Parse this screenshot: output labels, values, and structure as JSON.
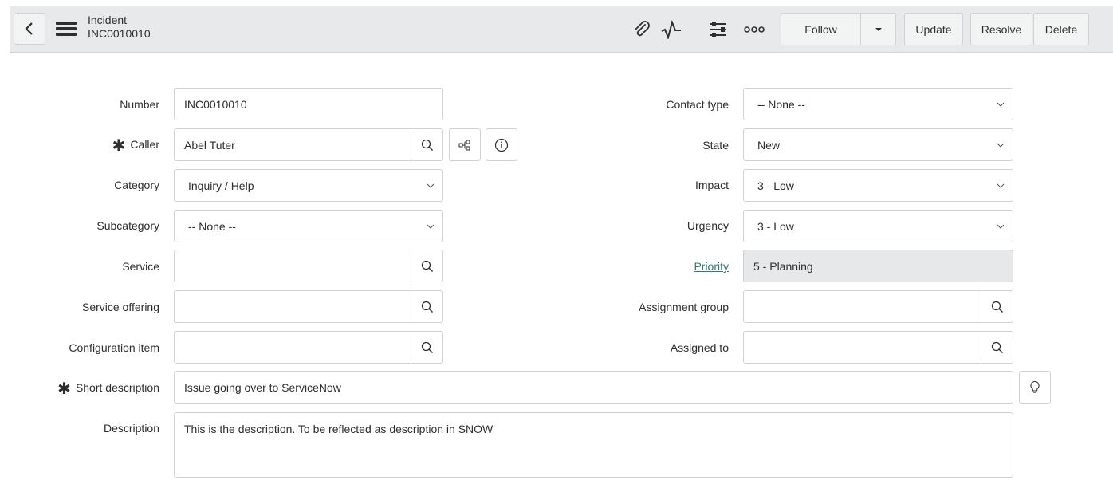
{
  "header": {
    "record_type": "Incident",
    "record_number": "INC0010010",
    "icons": [
      "back-icon",
      "hamburger-menu-icon",
      "paperclip-icon",
      "activity-icon",
      "settings-sliders-icon",
      "more-options-icon"
    ],
    "buttons": {
      "follow": "Follow",
      "update": "Update",
      "resolve": "Resolve",
      "delete": "Delete"
    }
  },
  "form": {
    "left": {
      "number": {
        "label": "Number",
        "value": "INC0010010"
      },
      "caller": {
        "label": "Caller",
        "value": "Abel Tuter",
        "mandatory": "✱"
      },
      "category": {
        "label": "Category",
        "value": "Inquiry / Help"
      },
      "subcategory": {
        "label": "Subcategory",
        "value": "-- None --"
      },
      "service": {
        "label": "Service",
        "value": ""
      },
      "service_offering": {
        "label": "Service offering",
        "value": ""
      },
      "configuration_item": {
        "label": "Configuration item",
        "value": ""
      }
    },
    "right": {
      "contact_type": {
        "label": "Contact type",
        "value": "-- None --"
      },
      "state": {
        "label": "State",
        "value": "New"
      },
      "impact": {
        "label": "Impact",
        "value": "3 - Low"
      },
      "urgency": {
        "label": "Urgency",
        "value": "3 - Low"
      },
      "priority": {
        "label": "Priority",
        "value": "5 - Planning"
      },
      "assignment_group": {
        "label": "Assignment group",
        "value": ""
      },
      "assigned_to": {
        "label": "Assigned to",
        "value": ""
      }
    },
    "short_description": {
      "label": "Short description",
      "value": "Issue going over to ServiceNow",
      "mandatory": "✱"
    },
    "description": {
      "label": "Description",
      "value": "This is the description. To be reflected as description in SNOW"
    }
  },
  "colors": {
    "header_bg": "#e8e9ea",
    "link": "#2f7d6d",
    "readonly_bg": "#e6e8ea"
  }
}
